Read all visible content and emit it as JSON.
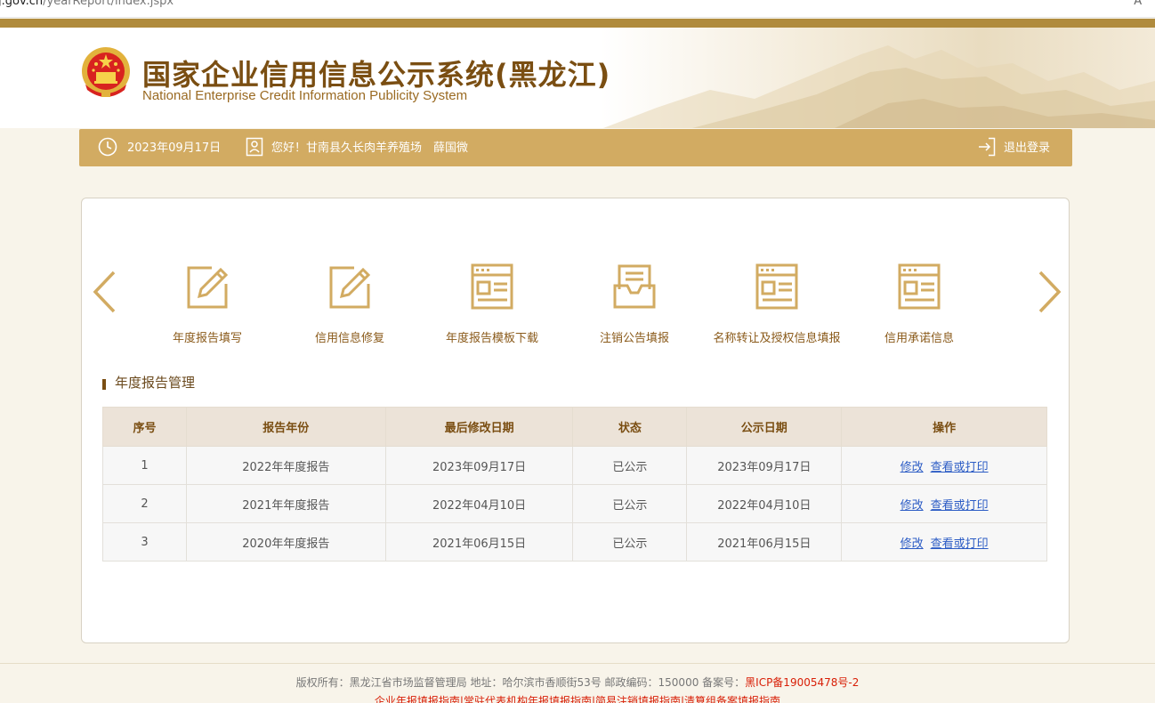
{
  "browser": {
    "url_host": "j.gov.cn",
    "url_path": "/yearReport/index.jspx",
    "reader_icon": "A^"
  },
  "header": {
    "title_cn": "国家企业信用信息公示系统(黑龙江)",
    "title_en": "National Enterprise Credit Information Publicity System",
    "emblem_icon": "national-emblem-icon"
  },
  "infobar": {
    "date": "2023年09月17日",
    "greeting": "您好！甘南县久长肉羊养殖场　薛国微",
    "logout_label": "退出登录"
  },
  "menu": {
    "items": [
      {
        "label": "年度报告填写",
        "icon": "edit-icon"
      },
      {
        "label": "信用信息修复",
        "icon": "edit-icon"
      },
      {
        "label": "年度报告模板下载",
        "icon": "document-template-icon"
      },
      {
        "label": "注销公告填报",
        "icon": "announcement-icon"
      },
      {
        "label": "名称转让及授权信息填报",
        "icon": "document-template-icon"
      },
      {
        "label": "信用承诺信息",
        "icon": "document-template-icon"
      }
    ]
  },
  "section": {
    "title": "年度报告管理"
  },
  "table": {
    "headers": [
      "序号",
      "报告年份",
      "最后修改日期",
      "状态",
      "公示日期",
      "操作"
    ],
    "rows": [
      {
        "no": "1",
        "year": "2022年年度报告",
        "modified": "2023年09月17日",
        "status": "已公示",
        "publish": "2023年09月17日",
        "edit": "修改",
        "view": "查看或打印"
      },
      {
        "no": "2",
        "year": "2021年年度报告",
        "modified": "2022年04月10日",
        "status": "已公示",
        "publish": "2022年04月10日",
        "edit": "修改",
        "view": "查看或打印"
      },
      {
        "no": "3",
        "year": "2020年年度报告",
        "modified": "2021年06月15日",
        "status": "已公示",
        "publish": "2021年06月15日",
        "edit": "修改",
        "view": "查看或打印"
      }
    ]
  },
  "footer": {
    "copyright": "版权所有：黑龙江省市场监督管理局 地址：哈尔滨市香顺街53号 邮政编码：150000 备案号：",
    "icp": "黑ICP备19005478号-2",
    "links": "企业年报填报指南|常驻代表机构年报填报指南|简易注销填报指南|清算组备案填报指南"
  },
  "colors": {
    "gold": "#d2ab62",
    "brown": "#7a4e12",
    "link": "#2c5cc5",
    "icp_red": "#d81e06"
  }
}
